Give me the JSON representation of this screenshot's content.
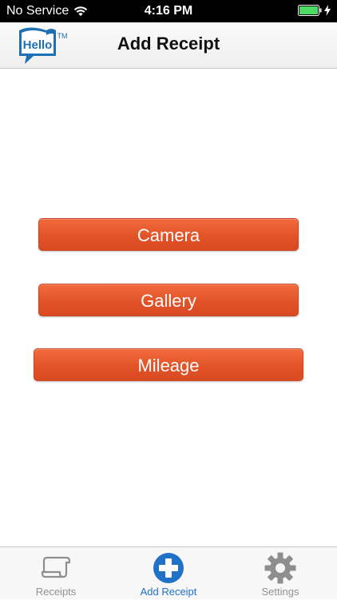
{
  "status_bar": {
    "carrier": "No Service",
    "time": "4:16 PM",
    "wifi_icon": "wifi-icon",
    "battery_icon": "battery-icon",
    "charging_icon": "bolt-icon",
    "battery_color": "#4cd964"
  },
  "nav": {
    "logo_text": "Hello",
    "logo_tm": "TM",
    "title": "Add Receipt"
  },
  "actions": {
    "camera_label": "Camera",
    "gallery_label": "Gallery",
    "mileage_label": "Mileage",
    "button_color": "#e25328"
  },
  "tabs": [
    {
      "label": "Receipts",
      "icon": "receipt-icon",
      "selected": false
    },
    {
      "label": "Add Receipt",
      "icon": "plus-circle-icon",
      "selected": true
    },
    {
      "label": "Settings",
      "icon": "gear-icon",
      "selected": false
    }
  ],
  "colors": {
    "accent": "#1f72c8",
    "inactive_tab": "#929292"
  }
}
